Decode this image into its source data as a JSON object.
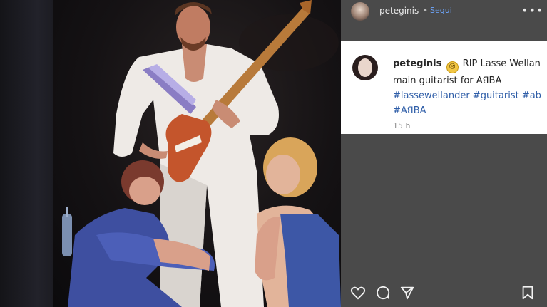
{
  "post_header": {
    "username": "peteginis",
    "separator": "•",
    "follow_label": "Segui",
    "more_label": "•••"
  },
  "caption": {
    "username": "peteginis",
    "emoji": "sad-face-emoji",
    "line1": "RIP Lasse Wellan",
    "line2": "main guitarist for AꓭBA",
    "hashtags_line1": "#lassewellander #guitarist #ab",
    "hashtags_line2": "#AꓭBA",
    "time": "15 h"
  },
  "actions": {
    "icons": [
      "heart-icon",
      "comment-icon",
      "share-icon",
      "bookmark-icon"
    ]
  },
  "colors": {
    "follow_link": "#6fa8ff",
    "hashtag": "#2f5ea8",
    "panel_bg": "#4a4a4a",
    "card_bg": "#ffffff"
  }
}
